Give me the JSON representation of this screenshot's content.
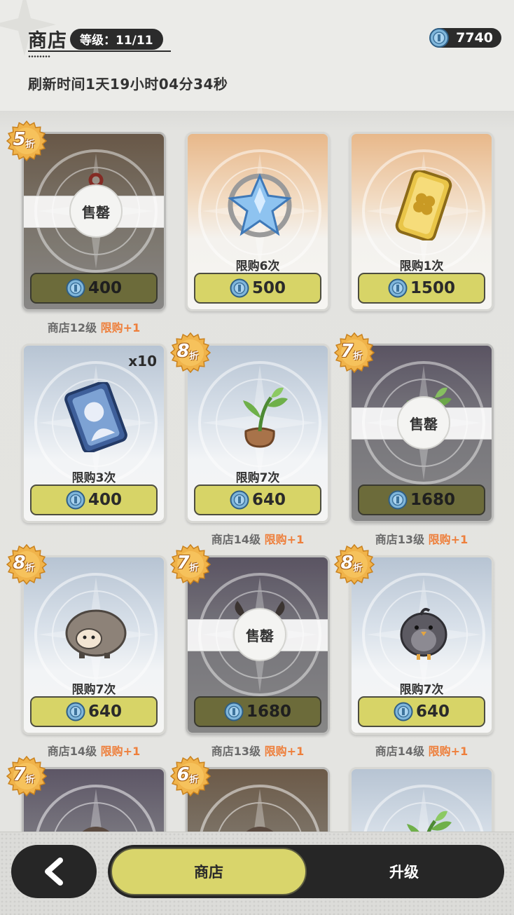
{
  "header": {
    "title": "商店",
    "level_label": "等级：11/11",
    "currency_amount": "7740",
    "refresh_text": "刷新时间1天19小时04分34秒"
  },
  "items": [
    {
      "theme": "brown",
      "sold": true,
      "sold_label": "售罄",
      "discount": "5",
      "discount_suffix": "折",
      "limit": "",
      "qty": "",
      "price": "400",
      "note_level": "商店12级",
      "note_plus": "限购+1",
      "icon": "compass-pendant-icon"
    },
    {
      "theme": "warm",
      "sold": false,
      "sold_label": "",
      "discount": "",
      "discount_suffix": "",
      "limit": "限购6次",
      "qty": "",
      "price": "500",
      "note_level": "",
      "note_plus": "",
      "icon": "crystal-cluster-icon"
    },
    {
      "theme": "warm",
      "sold": false,
      "sold_label": "",
      "discount": "",
      "discount_suffix": "",
      "limit": "限购1次",
      "qty": "",
      "price": "1500",
      "note_level": "",
      "note_plus": "",
      "icon": "clover-ticket-icon"
    },
    {
      "theme": "cool",
      "sold": false,
      "sold_label": "",
      "discount": "",
      "discount_suffix": "",
      "limit": "限购3次",
      "qty": "x10",
      "price": "400",
      "note_level": "",
      "note_plus": "",
      "icon": "character-card-icon"
    },
    {
      "theme": "cool",
      "sold": false,
      "sold_label": "",
      "discount": "8",
      "discount_suffix": "折",
      "limit": "限购7次",
      "qty": "",
      "price": "640",
      "note_level": "商店14级",
      "note_plus": "限购+1",
      "icon": "sapling-pot-icon"
    },
    {
      "theme": "dark",
      "sold": true,
      "sold_label": "售罄",
      "discount": "7",
      "discount_suffix": "折",
      "limit": "",
      "qty": "",
      "price": "1680",
      "note_level": "商店13级",
      "note_plus": "限购+1",
      "icon": "sapling-pot-icon"
    },
    {
      "theme": "cool",
      "sold": false,
      "sold_label": "",
      "discount": "8",
      "discount_suffix": "折",
      "limit": "限购7次",
      "qty": "",
      "price": "640",
      "note_level": "商店14级",
      "note_plus": "限购+1",
      "icon": "sheep-icon"
    },
    {
      "theme": "dark",
      "sold": true,
      "sold_label": "售罄",
      "discount": "7",
      "discount_suffix": "折",
      "limit": "",
      "qty": "",
      "price": "1680",
      "note_level": "商店13级",
      "note_plus": "限购+1",
      "icon": "goat-icon"
    },
    {
      "theme": "cool",
      "sold": false,
      "sold_label": "",
      "discount": "8",
      "discount_suffix": "折",
      "limit": "限购7次",
      "qty": "",
      "price": "640",
      "note_level": "商店14级",
      "note_plus": "限购+1",
      "icon": "gray-bird-icon"
    },
    {
      "theme": "dark",
      "sold": false,
      "sold_label": "",
      "discount": "7",
      "discount_suffix": "折",
      "limit": "",
      "qty": "",
      "price": "",
      "note_level": "",
      "note_plus": "",
      "icon": "item-icon"
    },
    {
      "theme": "brown",
      "sold": false,
      "sold_label": "",
      "discount": "6",
      "discount_suffix": "折",
      "limit": "",
      "qty": "",
      "price": "",
      "note_level": "",
      "note_plus": "",
      "icon": "item-icon"
    },
    {
      "theme": "cool",
      "sold": false,
      "sold_label": "",
      "discount": "",
      "discount_suffix": "",
      "limit": "",
      "qty": "",
      "price": "",
      "note_level": "",
      "note_plus": "",
      "icon": "sapling-pot-icon"
    }
  ],
  "footer": {
    "tab_shop": "商店",
    "tab_upgrade": "升级"
  },
  "colors": {
    "price_button": "#d7d467",
    "price_button_sold": "#6c6b3a",
    "discount_badge": "#f0b34a",
    "note_plus": "#ee7f3b",
    "dark_ui": "#262626"
  }
}
